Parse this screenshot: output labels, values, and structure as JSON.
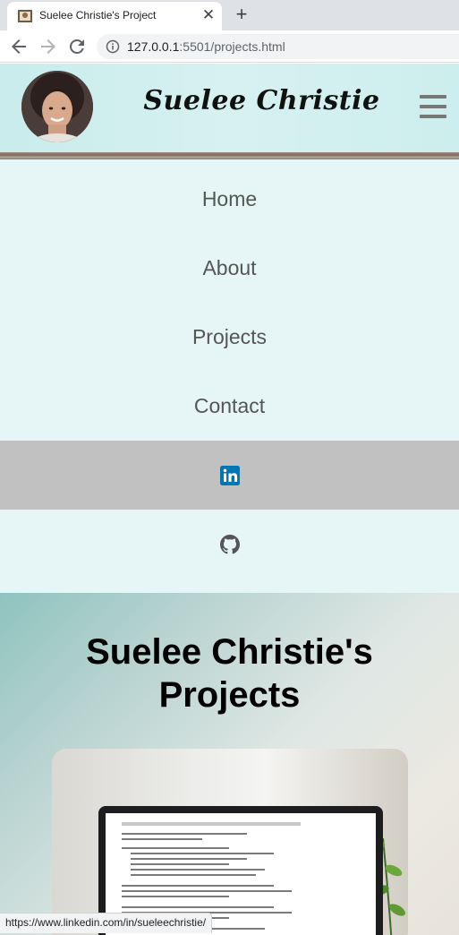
{
  "browser": {
    "tab_title": "Suelee Christie's Project",
    "url_host": "127.0.0.1",
    "url_rest": ":5501/projects.html",
    "status_url": "https://www.linkedin.com/in/sueleechristie/"
  },
  "header": {
    "brand": "Suelee Christie",
    "menu_icon": "hamburger-icon"
  },
  "nav": {
    "items": [
      {
        "label": "Home"
      },
      {
        "label": "About"
      },
      {
        "label": "Projects"
      },
      {
        "label": "Contact"
      }
    ]
  },
  "social": {
    "linkedin_icon": "linkedin-icon",
    "github_icon": "github-icon",
    "linkedin_color": "#0077b5",
    "github_color": "#555555"
  },
  "hero": {
    "title_line1": "Suelee Christie's",
    "title_line2": "Projects"
  },
  "colors": {
    "menu_bg": "#e6f6f6",
    "active_social_bg": "#c1c1c1",
    "menu_text": "#555555"
  }
}
